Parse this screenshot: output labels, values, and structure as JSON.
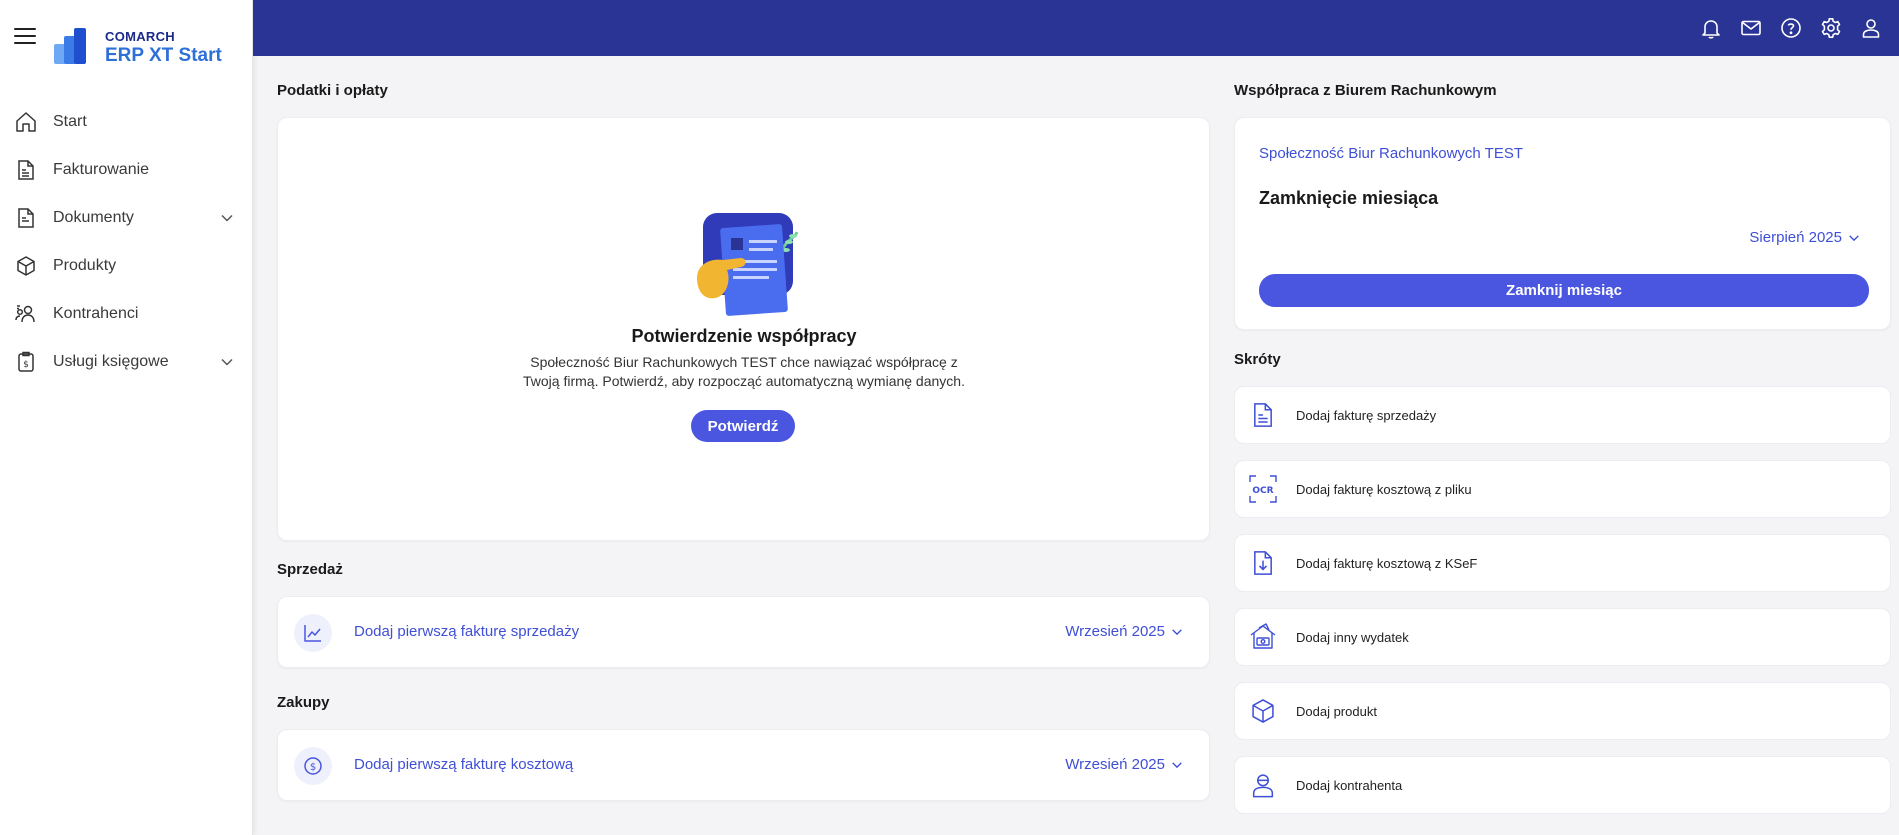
{
  "brand": {
    "company": "COMARCH",
    "product": "ERP XT Start"
  },
  "sidebar": {
    "items": [
      {
        "label": "Start"
      },
      {
        "label": "Fakturowanie"
      },
      {
        "label": "Dokumenty"
      },
      {
        "label": "Produkty"
      },
      {
        "label": "Kontrahenci"
      },
      {
        "label": "Usługi księgowe"
      }
    ]
  },
  "taxes": {
    "title": "Podatki i opłaty",
    "heading": "Potwierdzenie współpracy",
    "message": "Społeczność Biur Rachunkowych TEST chce nawiązać współpracę z Twoją firmą. Potwierdź, aby rozpocząć automatyczną wymianę danych.",
    "confirm_label": "Potwierdź"
  },
  "sales": {
    "title": "Sprzedaż",
    "link": "Dodaj pierwszą fakturę sprzedaży",
    "month": "Wrzesień 2025"
  },
  "purchases": {
    "title": "Zakupy",
    "link": "Dodaj pierwszą fakturę kosztową",
    "month": "Wrzesień 2025"
  },
  "office": {
    "title": "Współpraca z Biurem Rachunkowym",
    "name": "Społeczność Biur Rachunkowych TEST",
    "closing_title": "Zamknięcie miesiąca",
    "month": "Sierpień 2025",
    "close_label": "Zamknij miesiąc"
  },
  "shortcuts": {
    "title": "Skróty",
    "items": [
      {
        "label": "Dodaj fakturę sprzedaży",
        "icon": "invoice-icon"
      },
      {
        "label": "Dodaj fakturę kosztową z pliku",
        "icon": "ocr-icon"
      },
      {
        "label": "Dodaj fakturę kosztową z KSeF",
        "icon": "ksef-download-icon"
      },
      {
        "label": "Dodaj inny wydatek",
        "icon": "expense-icon"
      },
      {
        "label": "Dodaj produkt",
        "icon": "box-icon"
      },
      {
        "label": "Dodaj kontrahenta",
        "icon": "person-icon"
      }
    ]
  },
  "colors": {
    "topbar": "#2a3494",
    "accent": "#4a55e0",
    "link": "#3f4fd6",
    "background": "#f4f4f6"
  }
}
